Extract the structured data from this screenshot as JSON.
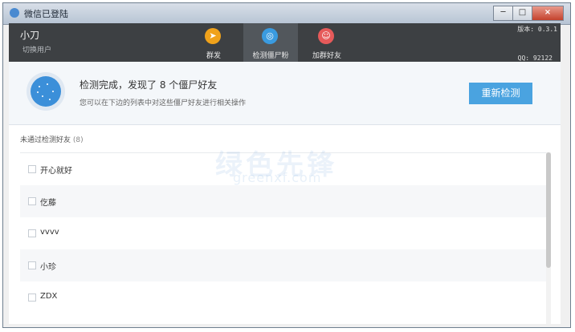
{
  "window": {
    "title": "微信已登陆",
    "buttons": {
      "minimize": "─",
      "maximize": "□",
      "close": "×"
    }
  },
  "topbar": {
    "user_name": "小刀",
    "switch_user": "切换用户",
    "version": "版本: 0.3.1",
    "qq": "QQ: 92122",
    "nav": [
      {
        "label": "群发",
        "icon": "paper-plane-icon",
        "color": "#f0a21b",
        "glyph": "➤"
      },
      {
        "label": "检测僵尸粉",
        "icon": "detect-icon",
        "color": "#3a9be0",
        "glyph": "◎"
      },
      {
        "label": "加群好友",
        "icon": "add-friend-icon",
        "color": "#e65a5a",
        "glyph": "☺"
      }
    ],
    "active_nav": 1
  },
  "result": {
    "title": "检测完成，发现了 8 个僵尸好友",
    "subtitle": "您可以在下边的列表中对这些僵尸好友进行相关操作",
    "button": "重新检测",
    "icon": "globe-icon",
    "accent": "#4aa3e0"
  },
  "list": {
    "header": "未通过检测好友",
    "count": "(8)",
    "items": [
      {
        "name": "开心就好"
      },
      {
        "name": "仡藤"
      },
      {
        "name": "vvvv"
      },
      {
        "name": "小珍"
      },
      {
        "name": "ZDX"
      }
    ]
  },
  "watermark": {
    "text": "绿色先锋",
    "url": "greenxf.com"
  }
}
